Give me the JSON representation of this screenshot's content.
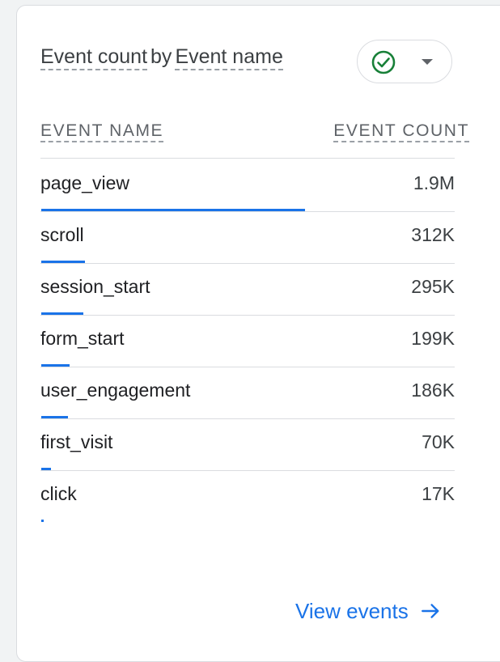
{
  "card": {
    "title_metric": "Event count",
    "title_by": "by",
    "title_dimension": "Event name",
    "status_icon": "check-circle-icon",
    "status_color": "#188038"
  },
  "table": {
    "header_left": "EVENT NAME",
    "header_right": "EVENT COUNT",
    "bar_color": "#1a73e8",
    "rows": [
      {
        "name": "page_view",
        "count": "1.9M",
        "fraction": 1.0
      },
      {
        "name": "scroll",
        "count": "312K",
        "fraction": 0.167
      },
      {
        "name": "session_start",
        "count": "295K",
        "fraction": 0.158
      },
      {
        "name": "form_start",
        "count": "199K",
        "fraction": 0.106
      },
      {
        "name": "user_engagement",
        "count": "186K",
        "fraction": 0.1
      },
      {
        "name": "first_visit",
        "count": "70K",
        "fraction": 0.037
      },
      {
        "name": "click",
        "count": "17K",
        "fraction": 0.009
      }
    ]
  },
  "footer": {
    "link_label": "View events",
    "link_icon": "arrow-right-icon"
  }
}
